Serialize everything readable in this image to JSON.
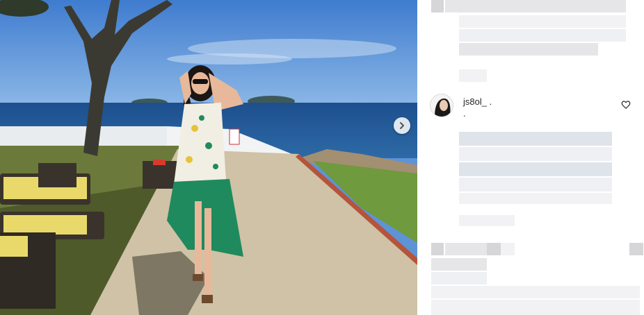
{
  "post": {
    "comment": {
      "username": "js8ol_ .",
      "text": "."
    }
  },
  "icons": {
    "next": "chevron-right-icon",
    "like": "heart-icon"
  }
}
